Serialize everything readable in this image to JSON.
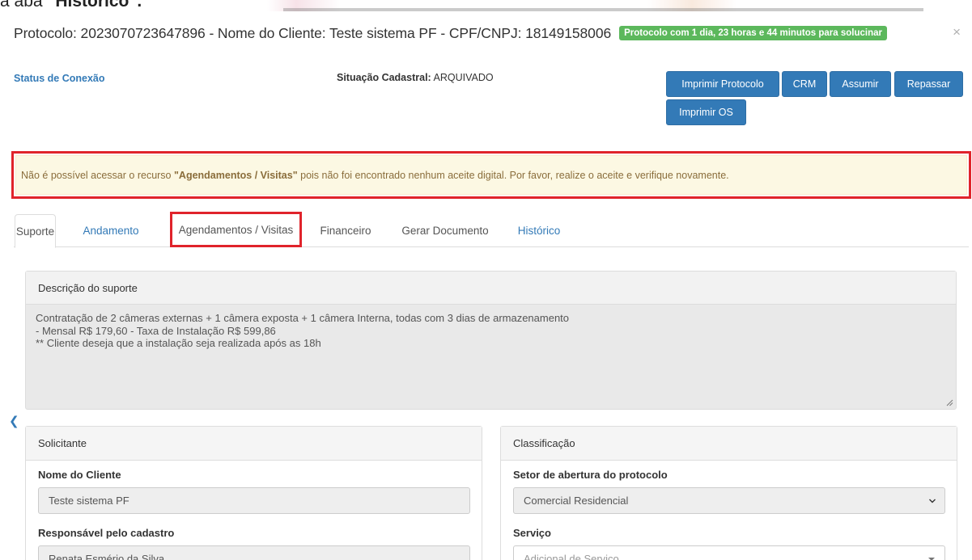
{
  "top_strip": {
    "prefix": "a aba ",
    "bold": "\"Histórico\".",
    "icon": "tab-icon"
  },
  "modal": {
    "title": "Protocolo: 2023070723647896 - Nome do Cliente: Teste sistema PF - CPF/CNPJ: 18149158006",
    "sla_badge": "Protocolo com 1 dia, 23 horas e 44 minutos para solucinar",
    "close": "×",
    "badge_color": "#5cb85c"
  },
  "status": {
    "link": "Status de Conexão",
    "situacao_label": "Situação Cadastral:",
    "situacao_value": " ARQUIVADO"
  },
  "buttons": {
    "imprimir_protocolo": "Imprimir Protocolo",
    "crm": "CRM",
    "assumir": "Assumir",
    "repassar": "Repassar",
    "imprimir_os": "Imprimir OS"
  },
  "alert": {
    "before": "Não é possível acessar o recurso ",
    "bold": "\"Agendamentos / Visitas\"",
    "after": " pois não foi encontrado nenhum aceite digital. Por favor, realize o aceite e verifique novamente.",
    "highlight_color": "#e0232b"
  },
  "tabs": [
    {
      "label": "Suporte",
      "active": true
    },
    {
      "label": "Andamento",
      "active": false
    },
    {
      "label": "Agendamentos / Visitas",
      "active": false
    },
    {
      "label": "Financeiro",
      "active": false
    },
    {
      "label": "Gerar Documento",
      "active": false
    },
    {
      "label": "Histórico",
      "active": false
    }
  ],
  "descricao": {
    "heading": "Descrição do suporte",
    "lines": [
      "Contratação de 2 câmeras externas + 1 câmera exposta + 1 câmera Interna, todas com 3 dias de armazenamento",
      "- Mensal R$ 179,60 - Taxa de Instalação R$ 599,86",
      "** Cliente deseja que a instalação seja realizada após as 18h"
    ]
  },
  "collapse_icon": "chevron-left-icon",
  "solicitante": {
    "heading": "Solicitante",
    "nome_label": "Nome do Cliente",
    "nome_value": "Teste sistema PF",
    "responsavel_label": "Responsável pelo cadastro",
    "responsavel_value": "Renata Esmério da Silva"
  },
  "classificacao": {
    "heading": "Classificação",
    "setor_label": "Setor de abertura do protocolo",
    "setor_value": "Comercial Residencial",
    "servico_label": "Serviço",
    "servico_placeholder": "Adicional de Serviço"
  },
  "colors": {
    "primary": "#337ab7",
    "alert_bg": "#fcf8e3",
    "alert_text": "#8a6d3b"
  }
}
